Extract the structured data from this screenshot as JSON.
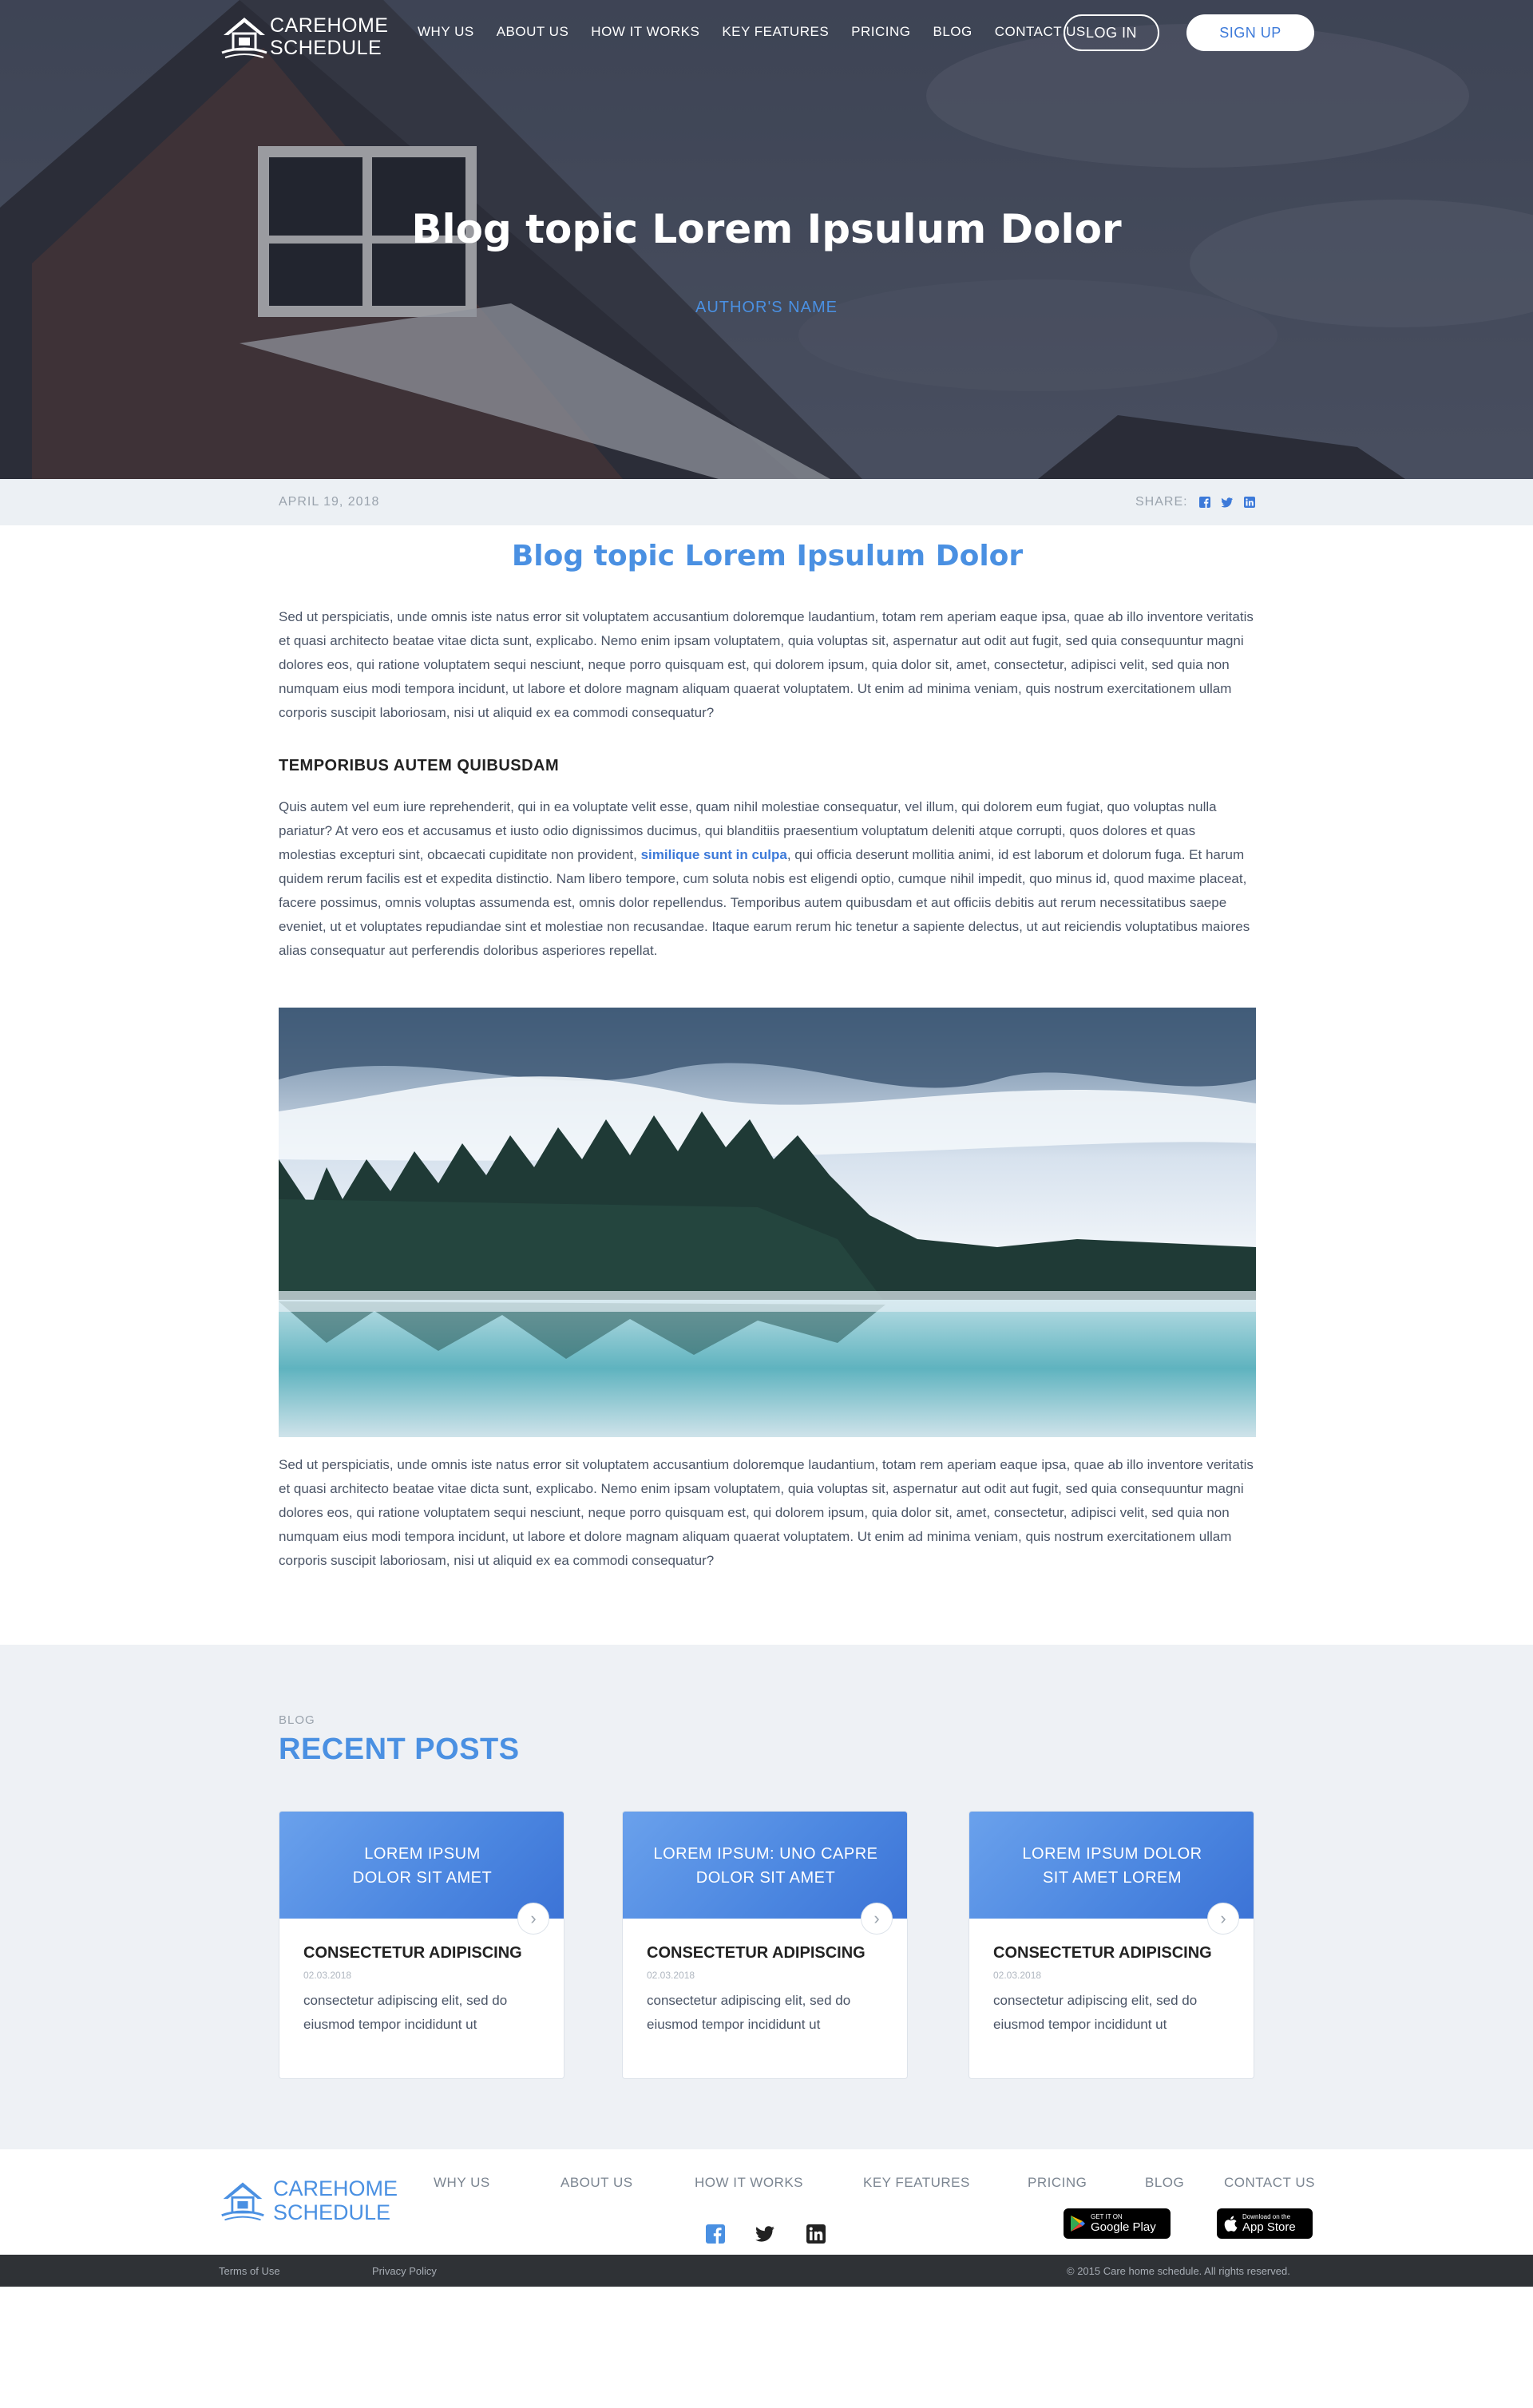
{
  "brand": {
    "line1": "CAREHOME",
    "line2": "SCHEDULE"
  },
  "nav": {
    "items": [
      "WHY US",
      "ABOUT US",
      "HOW IT WORKS",
      "KEY FEATURES",
      "PRICING",
      "BLOG",
      "CONTACT US"
    ],
    "login": "LOG IN",
    "signup": "SIGN UP"
  },
  "hero": {
    "title": "Blog topic Lorem Ipsulum Dolor",
    "author": "AUTHOR'S NAME"
  },
  "meta": {
    "date": "APRIL 19, 2018",
    "share_label": "SHARE:",
    "share_icons": [
      "facebook-icon",
      "twitter-icon",
      "linkedin-icon"
    ]
  },
  "article": {
    "title": "Blog topic Lorem Ipsulum Dolor",
    "p1": "Sed ut perspiciatis, unde omnis iste natus error sit voluptatem accusantium doloremque laudantium, totam rem aperiam eaque ipsa, quae ab illo inventore veritatis et quasi architecto beatae vitae dicta sunt, explicabo. Nemo enim ipsam voluptatem, quia voluptas sit, aspernatur aut odit aut fugit, sed quia consequuntur magni dolores eos, qui ratione voluptatem sequi nesciunt, neque porro quisquam est, qui dolorem ipsum, quia dolor sit, amet, consectetur, adipisci velit, sed quia non numquam eius modi tempora incidunt, ut labore et dolore magnam aliquam quaerat voluptatem. Ut enim ad minima veniam, quis nostrum exercitationem ullam corporis suscipit laboriosam, nisi ut aliquid ex ea commodi consequatur?",
    "subhead": "TEMPORIBUS AUTEM QUIBUSDAM",
    "p2_before": "Quis autem vel eum iure reprehenderit, qui in ea voluptate velit esse, quam nihil molestiae consequatur, vel illum, qui dolorem eum fugiat, quo voluptas nulla pariatur? At vero eos et accusamus et iusto odio dignissimos ducimus, qui blanditiis praesentium voluptatum deleniti atque corrupti, quos dolores et quas molestias excepturi sint, obcaecati cupiditate non provident, ",
    "p2_link": "similique sunt in culpa",
    "p2_after": ", qui officia deserunt mollitia animi, id est laborum et dolorum fuga. Et harum quidem rerum facilis est et expedita distinctio. Nam libero tempore, cum soluta nobis est eligendi optio, cumque nihil impedit, quo minus id, quod maxime placeat, facere possimus, omnis voluptas assumenda est, omnis dolor repellendus. Temporibus autem quibusdam et aut officiis debitis aut rerum necessitatibus saepe eveniet, ut et voluptates repudiandae sint et molestiae non recusandae. Itaque earum rerum hic tenetur a sapiente delectus, ut aut reiciendis voluptatibus maiores alias consequatur aut perferendis doloribus asperiores repellat.",
    "p3": "Sed ut perspiciatis, unde omnis iste natus error sit voluptatem accusantium doloremque laudantium, totam rem aperiam eaque ipsa, quae ab illo inventore veritatis et quasi architecto beatae vitae dicta sunt, explicabo. Nemo enim ipsam voluptatem, quia voluptas sit, aspernatur aut odit aut fugit, sed quia consequuntur magni dolores eos, qui ratione voluptatem sequi nesciunt, neque porro quisquam est, qui dolorem ipsum, quia dolor sit, amet, consectetur, adipisci velit, sed quia non numquam eius modi tempora incidunt, ut labore et dolore magnam aliquam quaerat voluptatem. Ut enim ad minima veniam, quis nostrum exercitationem ullam corporis suscipit laboriosam, nisi ut aliquid ex ea commodi consequatur?"
  },
  "recent": {
    "eyebrow": "BLOG",
    "title": "RECENT POSTS",
    "cards": [
      {
        "head_l1": "LOREM IPSUM",
        "head_l2": "DOLOR SIT AMET",
        "title": "CONSECTETUR ADIPISCING",
        "date": "02.03.2018",
        "desc": "consectetur adipiscing elit, sed do eiusmod tempor incididunt ut"
      },
      {
        "head_l1": "LOREM IPSUM: UNO CAPRE",
        "head_l2": "DOLOR SIT AMET",
        "title": "CONSECTETUR ADIPISCING",
        "date": "02.03.2018",
        "desc": "consectetur adipiscing elit, sed do eiusmod tempor incididunt ut"
      },
      {
        "head_l1": "LOREM IPSUM DOLOR",
        "head_l2": "SIT AMET LOREM",
        "title": "CONSECTETUR ADIPISCING",
        "date": "02.03.2018",
        "desc": "consectetur adipiscing elit, sed do eiusmod tempor incididunt ut"
      }
    ]
  },
  "footer": {
    "menu": [
      "WHY US",
      "ABOUT US",
      "HOW IT WORKS",
      "KEY FEATURES",
      "PRICING",
      "BLOG",
      "CONTACT US"
    ],
    "social_icons": [
      "facebook-icon",
      "twitter-icon",
      "linkedin-icon"
    ],
    "google_play": {
      "small": "GET IT ON",
      "big": "Google Play"
    },
    "app_store": {
      "small": "Download on the",
      "big": "App Store"
    },
    "terms": "Terms of Use",
    "privacy": "Privacy Policy",
    "copyright": "© 2015 Care home schedule. All rights reserved."
  },
  "colors": {
    "accent": "#4a90e2",
    "hero_overlay": "#3a3f4d",
    "meta_bar": "#ecf0f4",
    "recent_bg": "#eef1f5",
    "bottom_bar": "#2f3236"
  }
}
